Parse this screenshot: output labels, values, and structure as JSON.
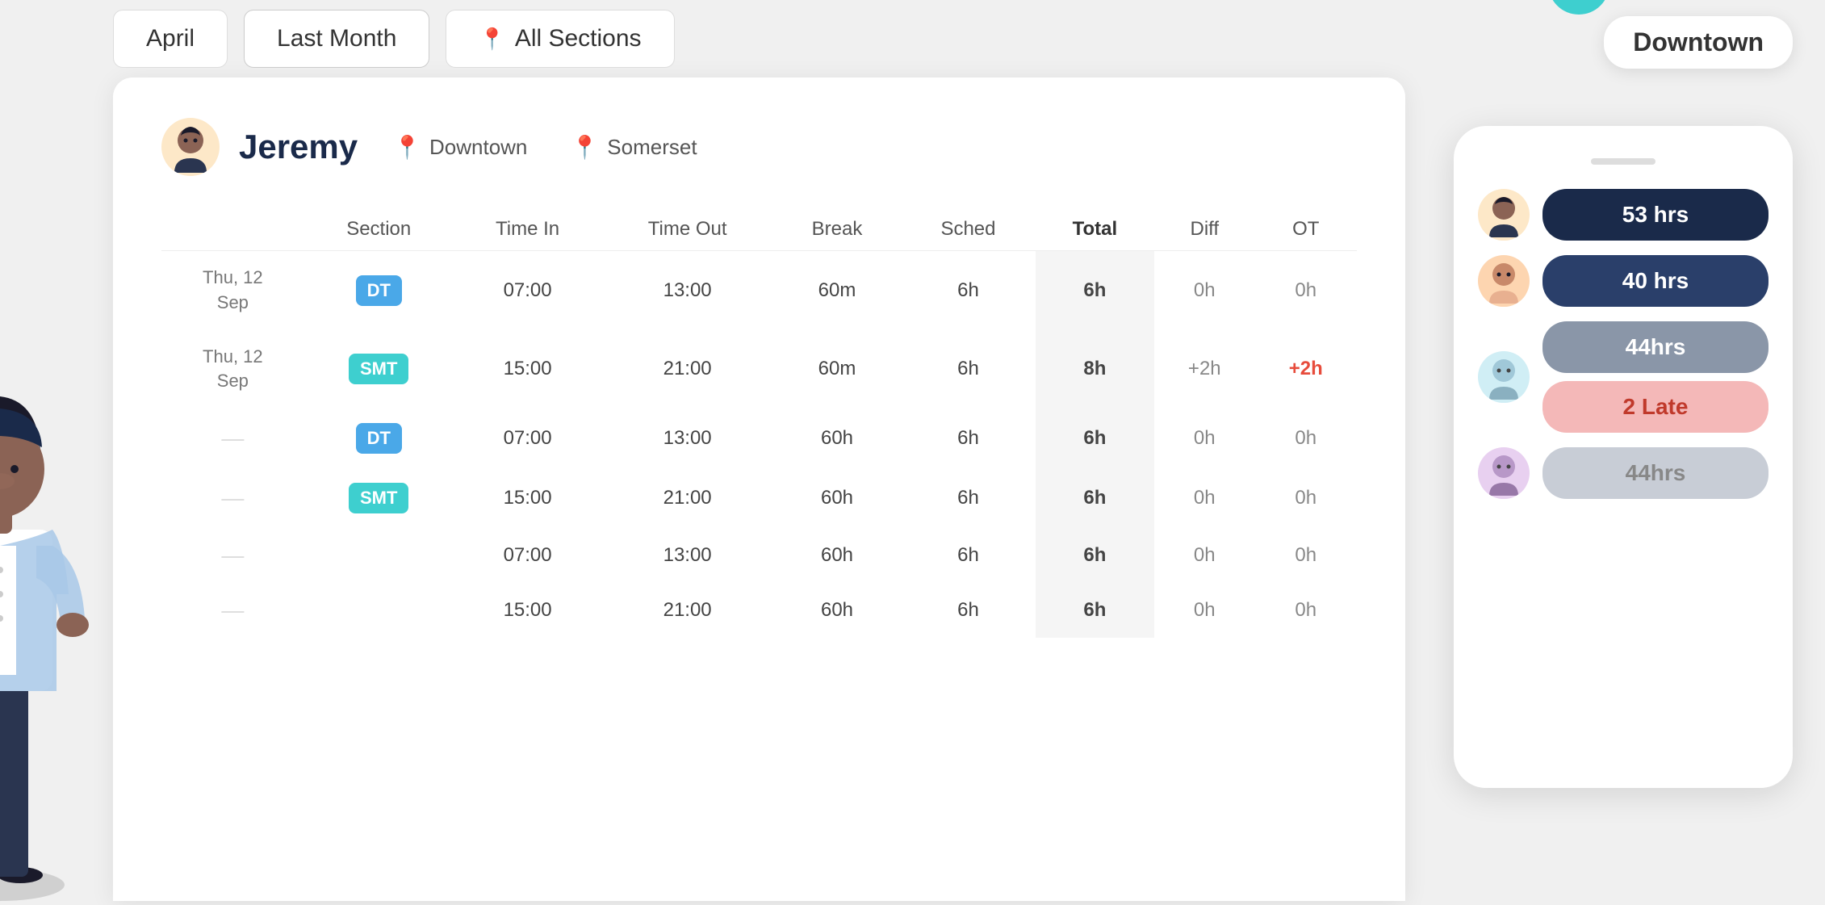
{
  "topBar": {
    "btn1": "April",
    "btn2": "Last Month",
    "btn3": "All Sections",
    "btn3_icon": "📍"
  },
  "floatingLabel": "Downtown",
  "employee": {
    "name": "Jeremy",
    "locations": [
      "Downtown",
      "Somerset"
    ],
    "avatar_color": "#fde8c8"
  },
  "tableHeaders": [
    "Section",
    "Time In",
    "Time Out",
    "Break",
    "Sched",
    "Total",
    "Diff",
    "OT"
  ],
  "tableRows": [
    {
      "date": "Thu, 12\nSep",
      "section": "DT",
      "section_type": "dt",
      "timeIn": "07:00",
      "timeOut": "13:00",
      "break": "60m",
      "sched": "6h",
      "total": "6h",
      "diff": "0h",
      "ot": "0h"
    },
    {
      "date": "Thu, 12\nSep",
      "section": "SMT",
      "section_type": "smt",
      "timeIn": "15:00",
      "timeOut": "21:00",
      "break": "60m",
      "sched": "6h",
      "total": "8h",
      "diff": "+2h",
      "ot": "+2h",
      "diff_positive": true,
      "ot_positive": true
    },
    {
      "date": "—",
      "section": "DT",
      "section_type": "dt",
      "timeIn": "07:00",
      "timeOut": "13:00",
      "break": "60h",
      "sched": "6h",
      "total": "6h",
      "diff": "0h",
      "ot": "0h"
    },
    {
      "date": "—",
      "section": "SMT",
      "section_type": "smt",
      "timeIn": "15:00",
      "timeOut": "21:00",
      "break": "60h",
      "sched": "6h",
      "total": "6h",
      "diff": "0h",
      "ot": "0h"
    },
    {
      "date": "—",
      "section": "",
      "section_type": "",
      "timeIn": "07:00",
      "timeOut": "13:00",
      "break": "60h",
      "sched": "6h",
      "total": "6h",
      "diff": "0h",
      "ot": "0h"
    },
    {
      "date": "—",
      "section": "",
      "section_type": "",
      "timeIn": "15:00",
      "timeOut": "21:00",
      "break": "60h",
      "sched": "6h",
      "total": "6h",
      "diff": "0h",
      "ot": "0h"
    }
  ],
  "mobilePanel": {
    "employees": [
      {
        "hrs": "53 hrs",
        "style": "hrs-dark",
        "avatar": "emp-avatar-1"
      },
      {
        "hrs": "40 hrs",
        "style": "hrs-medium",
        "avatar": "emp-avatar-2"
      },
      {
        "hrs": "44hrs",
        "style": "hrs-gray",
        "avatar": "emp-avatar-3",
        "extra": "2 Late",
        "extra_style": "hrs-pink"
      },
      {
        "hrs": "44hrs",
        "style": "hrs-light-gray",
        "avatar": "emp-avatar-4"
      }
    ]
  }
}
